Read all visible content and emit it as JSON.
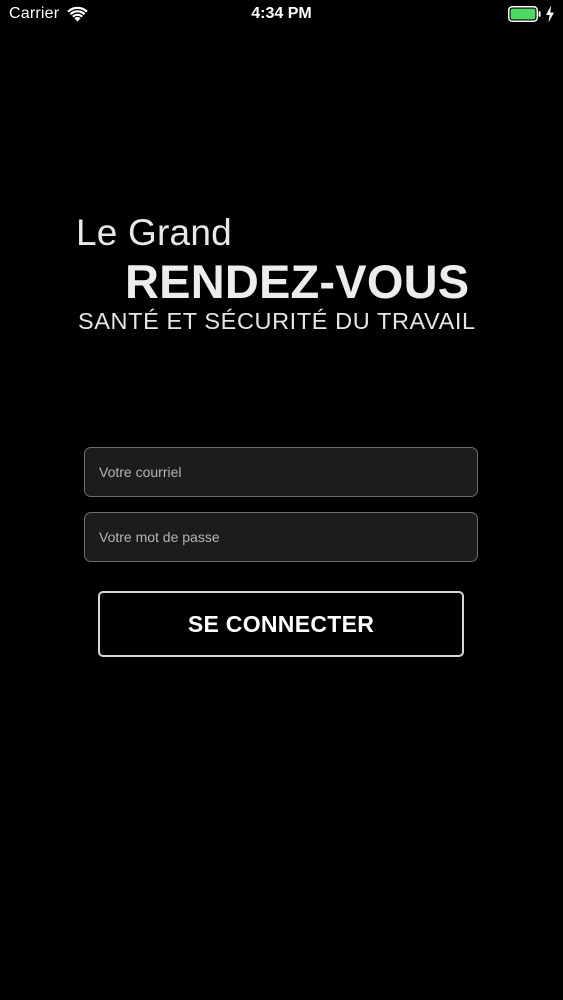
{
  "status_bar": {
    "carrier": "Carrier",
    "time": "4:34 PM",
    "wifi_icon": "wifi-icon",
    "battery_icon": "battery-icon",
    "charging_icon": "charging-bolt-icon",
    "battery_color": "#4cd964"
  },
  "logo": {
    "line1": "Le Grand",
    "line2": "RENDEZ-VOUS",
    "line3": "SANTÉ ET SÉCURITÉ DU TRAVAIL"
  },
  "login_form": {
    "email_placeholder": "Votre courriel",
    "email_value": "",
    "password_placeholder": "Votre mot de passe",
    "password_value": "",
    "submit_label": "SE CONNECTER"
  },
  "colors": {
    "background": "#000000",
    "field_background": "#1c1c1e",
    "field_border": "#6e6e6e",
    "text": "#ffffff",
    "placeholder": "#b4b4b4"
  }
}
